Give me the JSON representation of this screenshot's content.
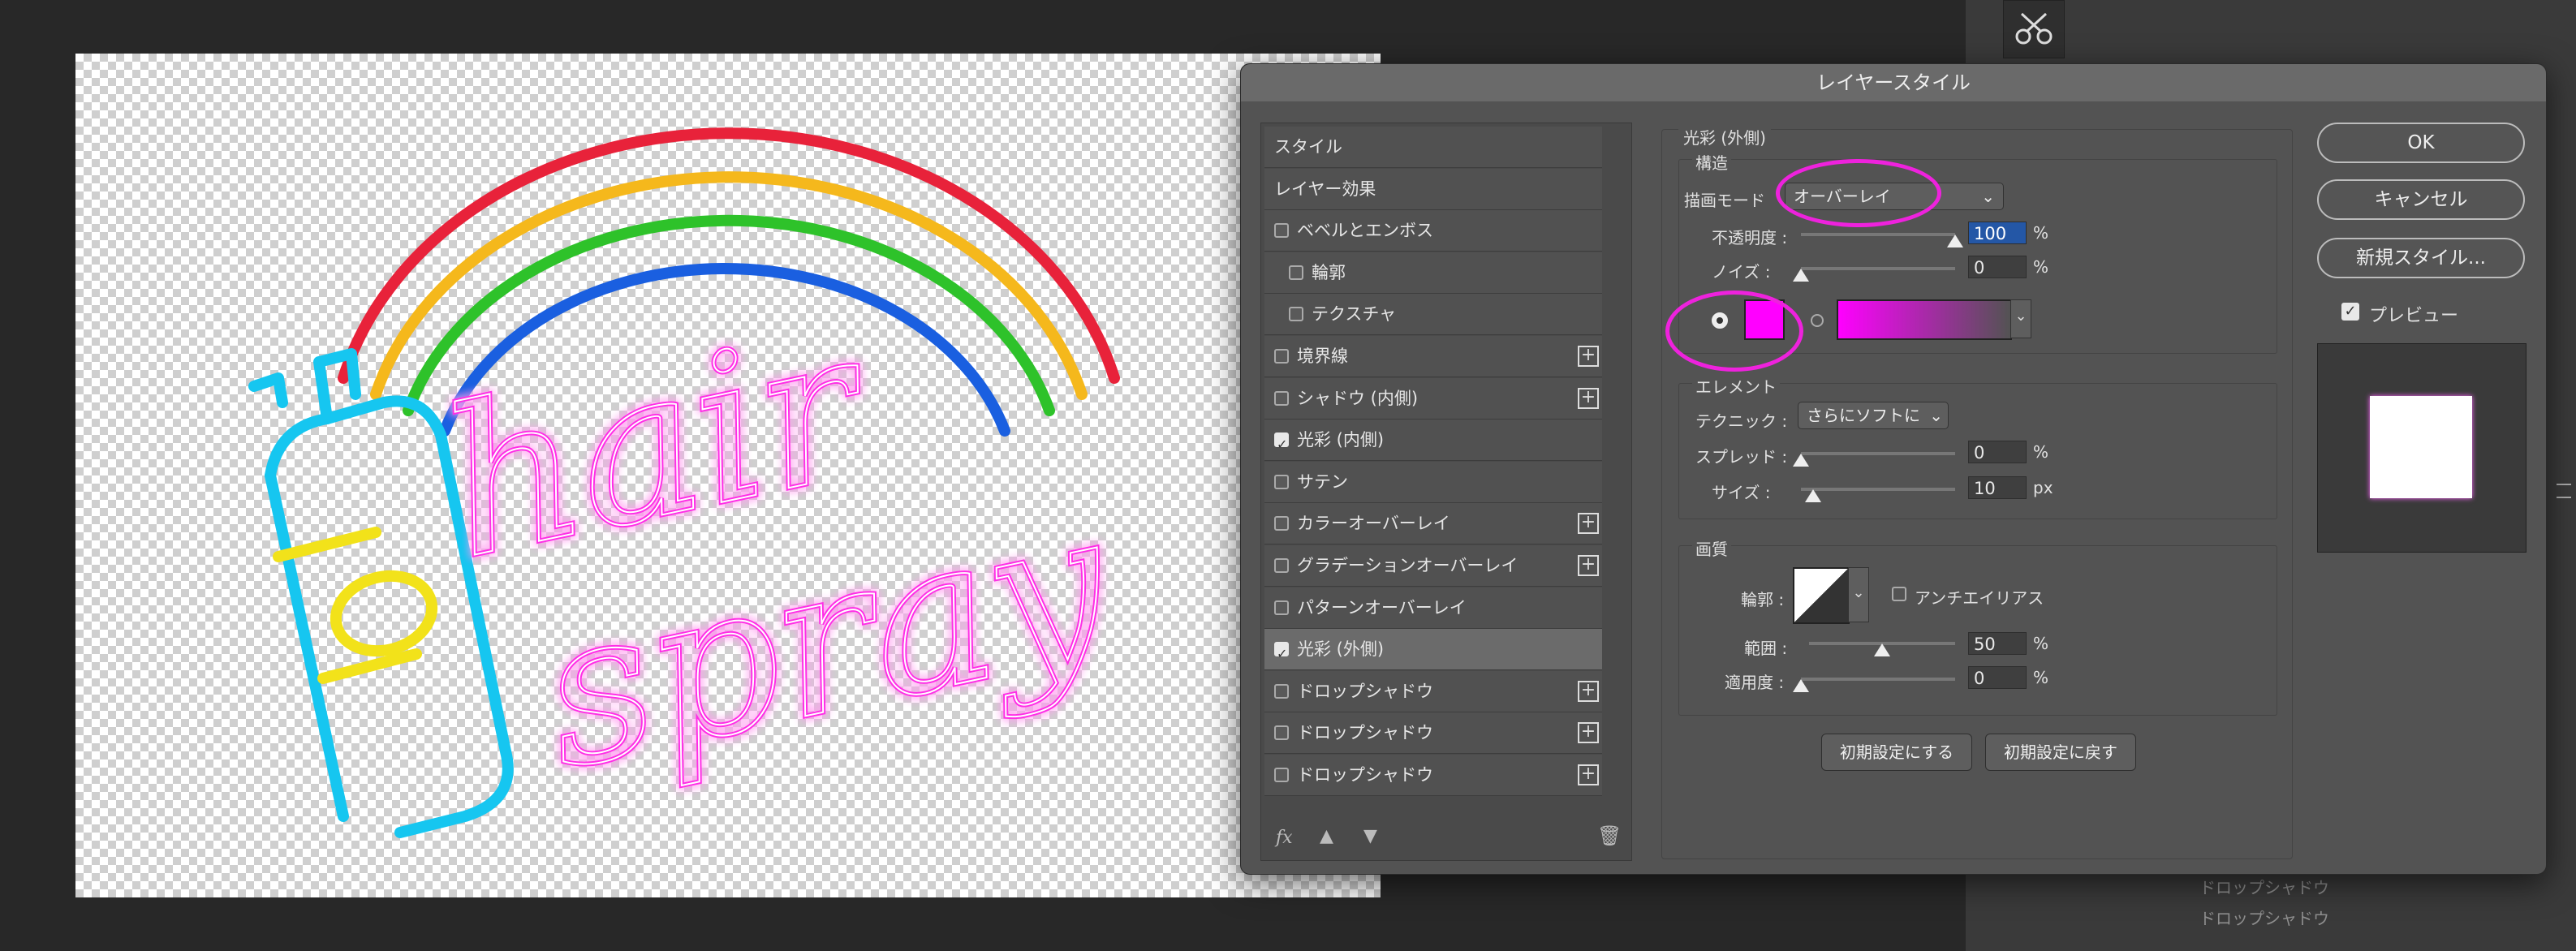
{
  "dialog": {
    "title": "レイヤースタイル",
    "buttons": {
      "ok": "OK",
      "cancel": "キャンセル",
      "new_style": "新規スタイル...",
      "preview": "プレビュー"
    },
    "style_list": [
      {
        "label": "スタイル",
        "checkbox": false,
        "plus": false,
        "checked": false,
        "indent": false
      },
      {
        "label": "レイヤー効果",
        "checkbox": false,
        "plus": false,
        "checked": false,
        "indent": false
      },
      {
        "label": "ベベルとエンボス",
        "checkbox": true,
        "plus": false,
        "checked": false,
        "indent": false
      },
      {
        "label": "輪郭",
        "checkbox": true,
        "plus": false,
        "checked": false,
        "indent": true
      },
      {
        "label": "テクスチャ",
        "checkbox": true,
        "plus": false,
        "checked": false,
        "indent": true
      },
      {
        "label": "境界線",
        "checkbox": true,
        "plus": true,
        "checked": false,
        "indent": false
      },
      {
        "label": "シャドウ (内側)",
        "checkbox": true,
        "plus": true,
        "checked": false,
        "indent": false
      },
      {
        "label": "光彩 (内側)",
        "checkbox": true,
        "plus": false,
        "checked": true,
        "indent": false
      },
      {
        "label": "サテン",
        "checkbox": true,
        "plus": false,
        "checked": false,
        "indent": false
      },
      {
        "label": "カラーオーバーレイ",
        "checkbox": true,
        "plus": true,
        "checked": false,
        "indent": false
      },
      {
        "label": "グラデーションオーバーレイ",
        "checkbox": true,
        "plus": true,
        "checked": false,
        "indent": false
      },
      {
        "label": "パターンオーバーレイ",
        "checkbox": true,
        "plus": false,
        "checked": false,
        "indent": false
      },
      {
        "label": "光彩 (外側)",
        "checkbox": true,
        "plus": false,
        "checked": true,
        "indent": false,
        "selected": true
      },
      {
        "label": "ドロップシャドウ",
        "checkbox": true,
        "plus": true,
        "checked": false,
        "indent": false
      },
      {
        "label": "ドロップシャドウ",
        "checkbox": true,
        "plus": true,
        "checked": false,
        "indent": false
      },
      {
        "label": "ドロップシャドウ",
        "checkbox": true,
        "plus": true,
        "checked": false,
        "indent": false
      }
    ],
    "list_footer": {
      "fx": "fx",
      "up_icon": "arrow-up-icon",
      "down_icon": "arrow-down-icon",
      "trash_icon": "trash-icon"
    },
    "panel": {
      "title": "光彩 (外側)",
      "structure": {
        "title": "構造",
        "blend_mode_label": "描画モード",
        "blend_mode_value": "オーバーレイ",
        "opacity_label": "不透明度 :",
        "opacity_value": "100",
        "opacity_level": 1.0,
        "noise_label": "ノイズ :",
        "noise_value": "0",
        "noise_level": 0.0,
        "percent": "%",
        "color": "#ff00ff"
      },
      "elements": {
        "title": "エレメント",
        "technique_label": "テクニック :",
        "technique_value": "さらにソフトに",
        "spread_label": "スプレッド :",
        "spread_value": "0",
        "spread_unit": "%",
        "spread_level": 0.0,
        "size_label": "サイズ :",
        "size_value": "10",
        "size_unit": "px",
        "size_level": 0.08
      },
      "quality": {
        "title": "画質",
        "contour_label": "輪郭 :",
        "antialias_label": "アンチエイリアス",
        "range_label": "範囲 :",
        "range_value": "50",
        "range_unit": "%",
        "range_level": 0.5,
        "jitter_label": "適用度 :",
        "jitter_value": "0",
        "jitter_unit": "%",
        "jitter_level": 0.0
      },
      "reset_default": "初期設定にする",
      "restore_default": "初期設定に戻す"
    }
  },
  "background_layers": {
    "item1": "ドロップシャドウ",
    "item2": "ドロップシャドウ"
  },
  "colors": {
    "accent": "#ff00ff",
    "annotation": "#ee22dd",
    "rainbow": [
      "#e8223a",
      "#f5b81c",
      "#2ec22a",
      "#1a5fe0"
    ],
    "bottle": "#16c6f0",
    "logo_ring": "#f2e21a"
  }
}
